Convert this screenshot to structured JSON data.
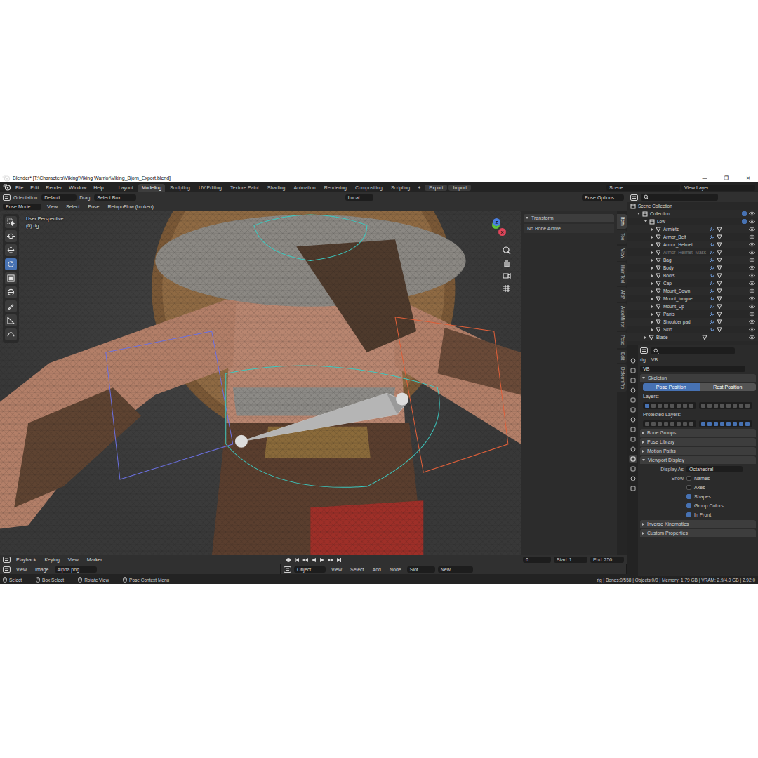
{
  "title_bar": {
    "title": "Blender* [T:\\Characters\\Viking\\Viking Warrior\\Viking_Bjorn_Export.blend]",
    "controls": [
      "—",
      "❐",
      "✕"
    ]
  },
  "menus": [
    "File",
    "Edit",
    "Render",
    "Window",
    "Help"
  ],
  "workspaces": [
    {
      "label": "Layout",
      "selected": false
    },
    {
      "label": "Modeling",
      "selected": true
    },
    {
      "label": "Sculpting",
      "selected": false
    },
    {
      "label": "UV Editing",
      "selected": false
    },
    {
      "label": "Texture Paint",
      "selected": false
    },
    {
      "label": "Shading",
      "selected": false
    },
    {
      "label": "Animation",
      "selected": false
    },
    {
      "label": "Rendering",
      "selected": false
    },
    {
      "label": "Compositing",
      "selected": false
    },
    {
      "label": "Scripting",
      "selected": false
    }
  ],
  "workspace_add": "+",
  "addon_buttons": [
    "Export",
    "Import"
  ],
  "scene": "Scene",
  "view_layer": "View Layer",
  "viewport_header": {
    "orientation_label": "Orientation:",
    "orientation": "Default",
    "drag_label": "Drag:",
    "drag": "Select Box",
    "pivot": "Local",
    "pose_options": "Pose Options"
  },
  "mode_header": {
    "mode": "Pose Mode",
    "menus": [
      "View",
      "Select",
      "Pose",
      "RetopoFlow (broken)"
    ]
  },
  "viewport": {
    "perspective": "User Perspective",
    "object": "(0) rig",
    "gizmo": [
      {
        "label": "X",
        "color": "#e0455a"
      },
      {
        "label": "Y",
        "color": "#5ec23a"
      },
      {
        "label": "Z",
        "color": "#4a7fe0"
      }
    ]
  },
  "tools": [
    {
      "kind": "select",
      "selected": false
    },
    {
      "kind": "cursor",
      "selected": false
    },
    {
      "kind": "move",
      "selected": false
    },
    {
      "kind": "rotate",
      "selected": true
    },
    {
      "kind": "scale",
      "selected": false
    },
    {
      "kind": "transform",
      "selected": false
    },
    {
      "kind": "annotate",
      "selected": false
    },
    {
      "kind": "measure",
      "selected": false
    },
    {
      "kind": "bend",
      "selected": false
    }
  ],
  "n_panel": {
    "title": "Transform",
    "message": "No Bone Active"
  },
  "side_tabs": [
    {
      "label": "Item",
      "selected": true
    },
    {
      "label": "Tool",
      "selected": false
    },
    {
      "label": "View",
      "selected": false
    },
    {
      "label": "Hair Tool",
      "selected": false
    },
    {
      "label": "ARP",
      "selected": false
    },
    {
      "label": "AutoMirror",
      "selected": false
    },
    {
      "label": "Pose",
      "selected": false
    },
    {
      "label": "Edit",
      "selected": false
    },
    {
      "label": "DeformPro",
      "selected": false
    }
  ],
  "timeline": {
    "menus": [
      "Playback",
      "Keying",
      "View",
      "Marker"
    ],
    "frame": "0",
    "start_label": "Start",
    "start": "1",
    "end_label": "End",
    "end": "250"
  },
  "image_editor": {
    "menus": [
      "View",
      "Image"
    ],
    "image": "Alpha.png"
  },
  "node_editor": {
    "mode": "Object",
    "menus": [
      "View",
      "Select",
      "Add",
      "Node"
    ],
    "slot": "Slot",
    "new": "New"
  },
  "status_bar": {
    "hints": [
      "Select",
      "Box Select",
      "Rotate View",
      "Pose Context Menu"
    ],
    "info": "rig | Bones:0/558 | Objects:0/0 | Memory: 1.79 GB | VRAM: 2.9/4.0 GB | 2.92.0"
  },
  "outliner": {
    "root": "Scene Collection",
    "collection": "Collection",
    "group": "Low",
    "items": [
      {
        "name": "Armlets",
        "disabled": false
      },
      {
        "name": "Armor_Belt",
        "disabled": false
      },
      {
        "name": "Armor_Helmet",
        "disabled": false
      },
      {
        "name": "Armor_Helmet_Mask",
        "disabled": true
      },
      {
        "name": "Bag",
        "disabled": false
      },
      {
        "name": "Body",
        "disabled": false
      },
      {
        "name": "Boots",
        "disabled": false
      },
      {
        "name": "Cap",
        "disabled": false
      },
      {
        "name": "Mount_Down",
        "disabled": false
      },
      {
        "name": "Mount_tongue",
        "disabled": false
      },
      {
        "name": "Mount_Up",
        "disabled": false
      },
      {
        "name": "Pants",
        "disabled": false
      },
      {
        "name": "Shoulder pad",
        "disabled": false
      },
      {
        "name": "Skirt",
        "disabled": false
      }
    ],
    "last": "Blade"
  },
  "properties": {
    "tabs": [
      {
        "selected": false
      },
      {
        "selected": false
      },
      {
        "selected": false
      },
      {
        "selected": false
      },
      {
        "selected": false
      },
      {
        "selected": false
      },
      {
        "selected": false
      },
      {
        "selected": false
      },
      {
        "selected": false
      },
      {
        "selected": false
      },
      {
        "selected": true
      },
      {
        "selected": false
      },
      {
        "selected": false
      },
      {
        "selected": false
      }
    ],
    "object": "rig",
    "data": "VB",
    "name": "VB",
    "skeleton": {
      "title": "Skeleton",
      "expanded": true,
      "positions": [
        {
          "label": "Pose Position",
          "selected": true
        },
        {
          "label": "Rest Position",
          "selected": false
        }
      ],
      "layers_label": "Layers:",
      "layers": [
        true,
        false,
        false,
        false,
        false,
        false,
        false,
        false,
        false,
        false,
        false,
        false,
        false,
        false,
        false,
        false
      ],
      "protected_label": "Protected Layers:",
      "protected": [
        false,
        false,
        false,
        false,
        false,
        false,
        false,
        false,
        true,
        true,
        true,
        true,
        true,
        true,
        true,
        true
      ]
    },
    "collapsed_panels": [
      "Bone Groups",
      "Pose Library",
      "Motion Paths"
    ],
    "viewport_display": {
      "title": "Viewport Display",
      "expanded": true,
      "display_as_label": "Display As",
      "display_as": "Octahedral",
      "show_label": "Show",
      "options": [
        {
          "label": "Names",
          "checked": false
        },
        {
          "label": "Axes",
          "checked": false
        },
        {
          "label": "Shapes",
          "checked": true
        },
        {
          "label": "Group Colors",
          "checked": true
        },
        {
          "label": "In Front",
          "checked": true
        }
      ]
    },
    "trailing_panels": [
      "Inverse Kinematics",
      "Custom Properties"
    ]
  }
}
